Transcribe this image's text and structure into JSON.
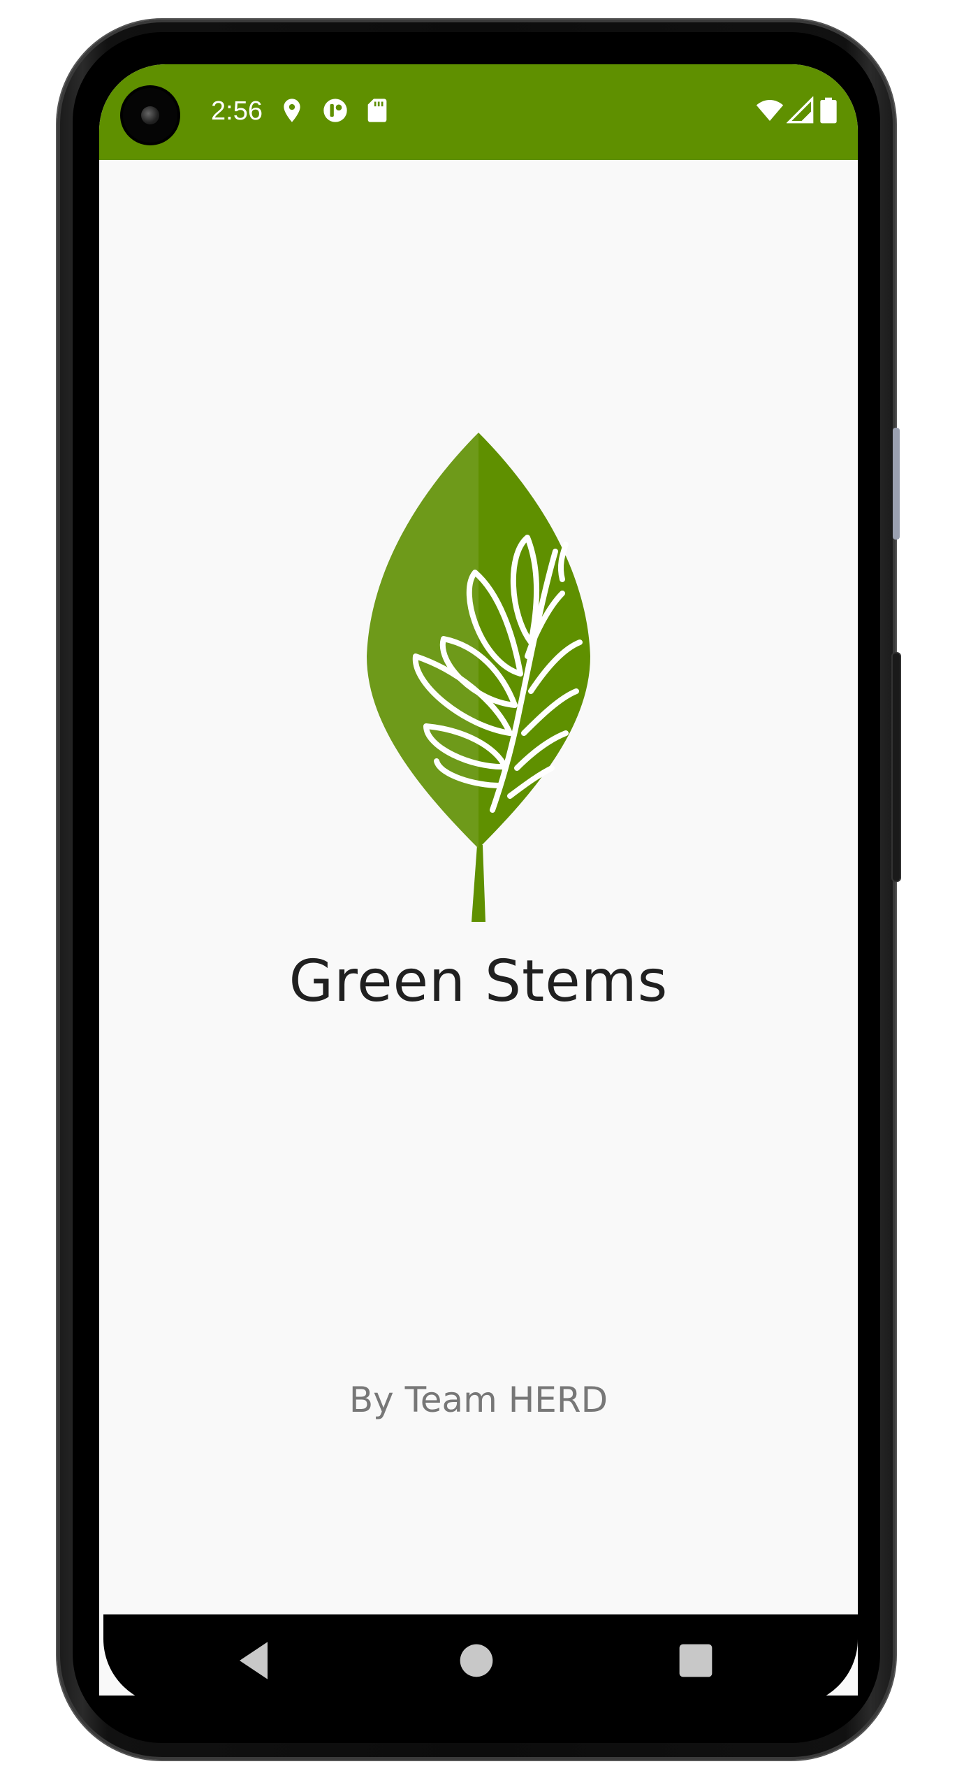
{
  "status_bar": {
    "time": "2:56",
    "background_color": "#5f9000",
    "left_icons": [
      "location-icon",
      "data-saver-icon",
      "sd-card-icon"
    ],
    "right_icons": [
      "wifi-icon",
      "cellular-signal-icon",
      "battery-icon"
    ]
  },
  "app": {
    "title": "Green Stems",
    "credit": "By Team HERD",
    "logo": "leaf-logo-icon",
    "leaf_color": "#6a9a10",
    "background_color": "#f9f9f9"
  },
  "navigation": {
    "buttons": [
      "back-icon",
      "home-icon",
      "recents-icon"
    ]
  }
}
